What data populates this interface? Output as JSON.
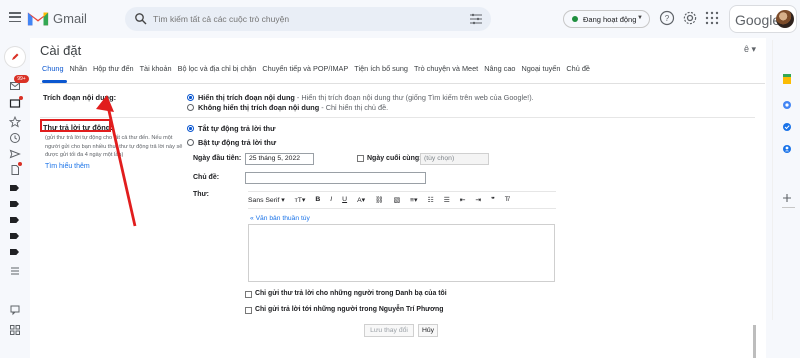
{
  "app": {
    "name": "Gmail"
  },
  "search": {
    "placeholder": "Tìm kiếm tất cả các cuộc trò chuyện"
  },
  "status": {
    "label": "Đang hoạt động"
  },
  "account": {
    "brand": "Google"
  },
  "rail": {
    "inbox_badge": "99+"
  },
  "page": {
    "title": "Cài đặt",
    "language": "ê ▾"
  },
  "tabs": [
    "Chung",
    "Nhãn",
    "Hộp thư đến",
    "Tài khoản",
    "Bộ lọc và địa chỉ bị chặn",
    "Chuyển tiếp và POP/IMAP",
    "Tiện ích bổ sung",
    "Trò chuyện và Meet",
    "Nâng cao",
    "Ngoại tuyến",
    "Chủ đề"
  ],
  "snippets": {
    "label": "Trích đoạn nội dung:",
    "show_bold": "Hiển thị trích đoạn nội dung",
    "show_desc": " - Hiển thị trích đoạn nội dung thư (giống Tìm kiếm trên web của Google!).",
    "hide_bold": "Không hiển thị trích đoạn nội dung",
    "hide_desc": " - Chỉ hiển thị chủ đề."
  },
  "autoreply": {
    "label": "Thư trả lời tự động:",
    "help": "(gửi thư trả lời tự động cho tất cả thư đến. Nếu một người gửi cho bạn nhiều thư, thư tự động trả lời này sẽ được gửi tối đa 4 ngày một lần)",
    "learn_more": "Tìm hiểu thêm",
    "off": "Tắt tự động trả lời thư",
    "on": "Bật tự động trả lời thư",
    "first_day_label": "Ngày đầu tiên:",
    "first_day_value": "25 tháng 5, 2022",
    "last_day_label": "Ngày cuối cùng:",
    "last_day_placeholder": "(tùy chọn)",
    "subject_label": "Chủ đề:",
    "message_label": "Thư:",
    "plain_text": "« Văn bản thuần túy",
    "contacts_only": "Chỉ gửi thư trả lời cho những người trong Danh bạ của tôi",
    "org_only": "Chỉ gửi trả lời tới những người trong Nguyễn Trí Phương"
  },
  "toolbar": {
    "font": "Sans Serif ▾",
    "size": "тT▾",
    "bold": "B",
    "italic": "I",
    "underline": "U",
    "color": "A▾",
    "align": "≡▾",
    "numbered": "☷",
    "bullets": "☰",
    "outdent": "⇤",
    "indent": "⇥",
    "quote": "❞",
    "clear": "T̸"
  },
  "buttons": {
    "save": "Lưu thay đổi",
    "cancel": "Hủy"
  },
  "colors": {
    "accent": "#0b57d0",
    "annotation": "#e11d1d"
  }
}
